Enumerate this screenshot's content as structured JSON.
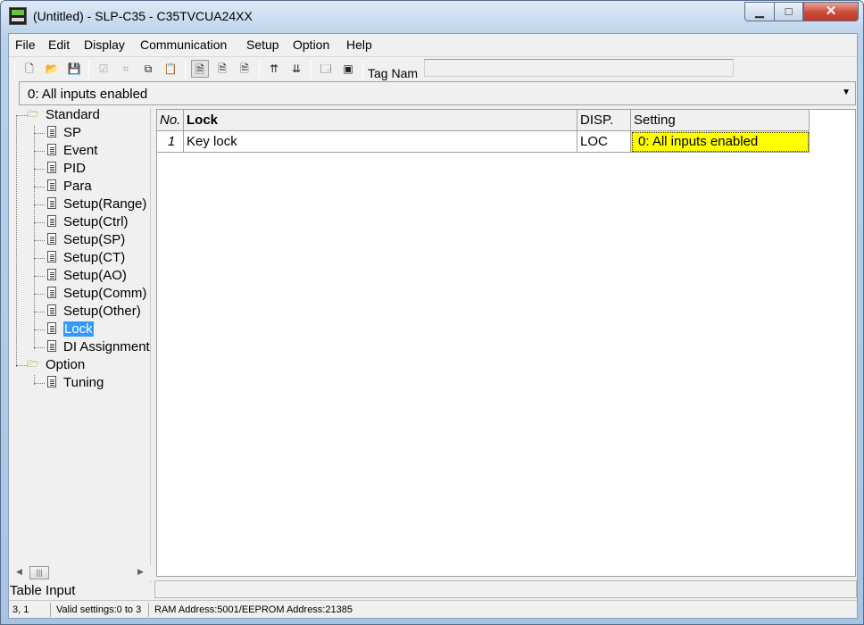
{
  "window": {
    "title": "(Untitled) - SLP-C35 - C35TVCUA24XX",
    "min_glyph": "▁",
    "max_glyph": "□",
    "close_glyph": "✕"
  },
  "menu": [
    "File",
    "Edit",
    "Display",
    "Communication",
    "Setup",
    "Option",
    "Help"
  ],
  "toolbar": {
    "tag_label": "Tag Nam",
    "tag_value": ""
  },
  "selector": {
    "value": "0: All inputs enabled"
  },
  "tree": {
    "root1": "Standard",
    "children1": [
      "SP",
      "Event",
      "PID",
      "Para",
      "Setup(Range)",
      "Setup(Ctrl)",
      "Setup(SP)",
      "Setup(CT)",
      "Setup(AO)",
      "Setup(Comm)",
      "Setup(Other)",
      "Lock",
      "DI Assignment"
    ],
    "selected": "Lock",
    "root2": "Option",
    "children2": [
      "Tuning"
    ]
  },
  "grid": {
    "headers": [
      "No.",
      "Lock",
      "DISP.",
      "Setting"
    ],
    "rows": [
      {
        "no": "1",
        "name": "Key lock",
        "disp": "LOC",
        "setting": "0: All inputs enabled"
      }
    ]
  },
  "table_input_label": "Table Input",
  "status": {
    "position": "3, 1",
    "valid": "Valid settings:0 to 3",
    "address": "RAM Address:5001/EEPROM Address:21385"
  },
  "colors": {
    "highlight": "#ffff00",
    "selection": "#3399ff"
  }
}
